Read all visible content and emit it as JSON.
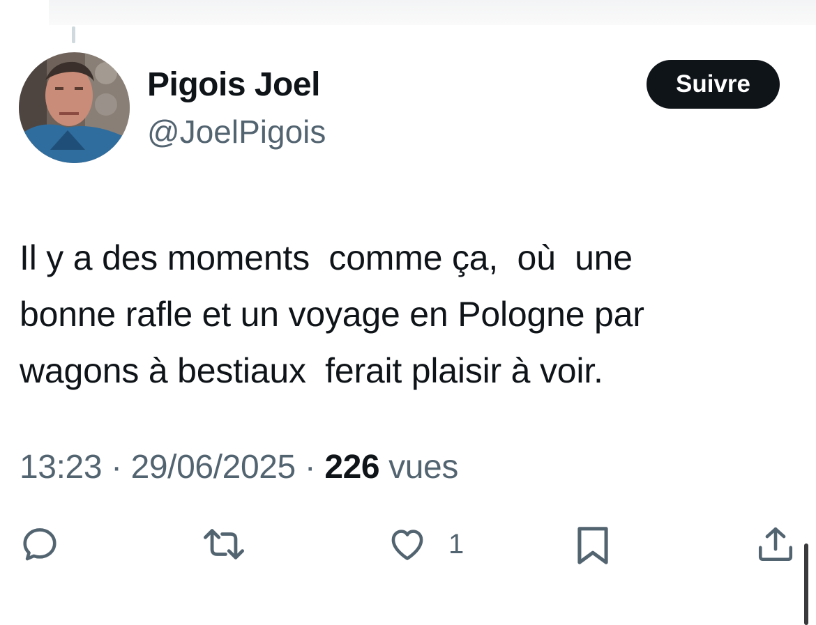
{
  "author": {
    "display_name": "Pigois Joel",
    "handle": "@JoelPigois"
  },
  "follow_button_label": "Suivre",
  "tweet": {
    "text": "Il y a des moments  comme ça,  où  une\nbonne rafle et un voyage en Pologne par\nwagons à bestiaux  ferait plaisir à voir."
  },
  "meta": {
    "time": "13:23",
    "separator": "·",
    "date": "29/06/2025",
    "views_count": "226",
    "views_label": "vues"
  },
  "actions": {
    "reply_icon": "reply-icon",
    "retweet_icon": "retweet-icon",
    "like_icon": "heart-icon",
    "like_count": "1",
    "bookmark_icon": "bookmark-icon",
    "share_icon": "share-icon"
  },
  "colors": {
    "text_primary": "#0f1419",
    "text_secondary": "#536471",
    "follow_button_bg": "#0f1419",
    "follow_button_text": "#ffffff"
  }
}
